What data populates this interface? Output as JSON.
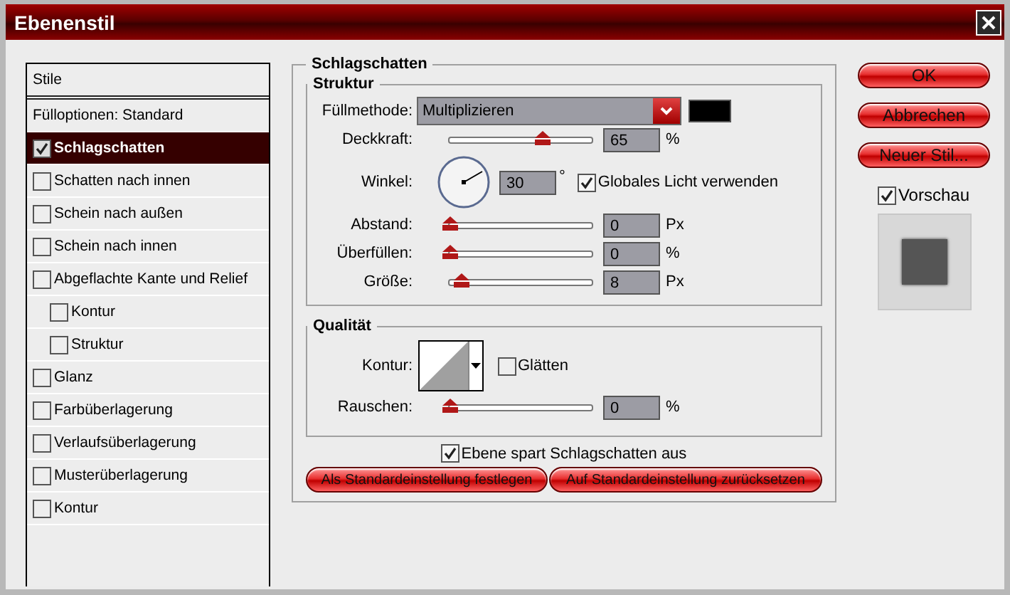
{
  "window": {
    "title": "Ebenenstil"
  },
  "styles_list": {
    "header": "Stile",
    "items": [
      {
        "label": "Fülloptionen: Standard",
        "kind": "plain",
        "selected": false
      },
      {
        "label": "Schlagschatten",
        "kind": "checkbox",
        "checked": true,
        "selected": true
      },
      {
        "label": "Schatten nach innen",
        "kind": "checkbox",
        "checked": false,
        "selected": false
      },
      {
        "label": "Schein nach außen",
        "kind": "checkbox",
        "checked": false,
        "selected": false
      },
      {
        "label": "Schein nach innen",
        "kind": "checkbox",
        "checked": false,
        "selected": false
      },
      {
        "label": "Abgeflachte Kante und Relief",
        "kind": "checkbox",
        "checked": false,
        "selected": false,
        "children": [
          {
            "label": "Kontur",
            "kind": "checkbox",
            "checked": false,
            "selected": false
          },
          {
            "label": "Struktur",
            "kind": "checkbox",
            "checked": false,
            "selected": false
          }
        ]
      },
      {
        "label": "Glanz",
        "kind": "checkbox",
        "checked": false,
        "selected": false
      },
      {
        "label": "Farbüberlagerung",
        "kind": "checkbox",
        "checked": false,
        "selected": false
      },
      {
        "label": "Verlaufsüberlagerung",
        "kind": "checkbox",
        "checked": false,
        "selected": false
      },
      {
        "label": "Musterüberlagerung",
        "kind": "checkbox",
        "checked": false,
        "selected": false
      },
      {
        "label": "Kontur",
        "kind": "checkbox",
        "checked": false,
        "selected": false
      }
    ]
  },
  "panel": {
    "title": "Schlagschatten",
    "structure": {
      "title": "Struktur",
      "rows": [
        {
          "kind": "select",
          "label": "Füllmethode:",
          "value": "Multiplizieren",
          "color": "#000000"
        },
        {
          "kind": "slider",
          "label": "Deckkraft:",
          "level": 0.65,
          "value": "65",
          "unit": "%"
        },
        {
          "kind": "angle",
          "label": "Winkel:",
          "value": "30",
          "unit": "°",
          "option": {
            "label": "Globales Licht verwenden",
            "checked": true
          }
        },
        {
          "kind": "slider",
          "label": "Abstand:",
          "level": 0,
          "value": "0",
          "unit": "Px"
        },
        {
          "kind": "slider",
          "label": "Überfüllen:",
          "level": 0,
          "value": "0",
          "unit": "%"
        },
        {
          "kind": "slider",
          "label": "Größe:",
          "level": 0.08,
          "value": "8",
          "unit": "Px"
        }
      ]
    },
    "quality": {
      "title": "Qualität",
      "rows": [
        {
          "kind": "contour",
          "label": "Kontur:",
          "option": {
            "label": "Glätten",
            "checked": false
          }
        },
        {
          "kind": "slider",
          "label": "Rauschen:",
          "level": 0,
          "value": "0",
          "unit": "%"
        }
      ]
    },
    "knockout": {
      "label": "Ebene spart Schlagschatten aus",
      "checked": true
    },
    "buttons": [
      "Als Standardeinstellung festlegen",
      "Auf Standardeinstellung zurücksetzen"
    ]
  },
  "actions": {
    "buttons": [
      "OK",
      "Abbrechen",
      "Neuer Stil..."
    ],
    "preview": {
      "label": "Vorschau",
      "checked": true
    }
  }
}
